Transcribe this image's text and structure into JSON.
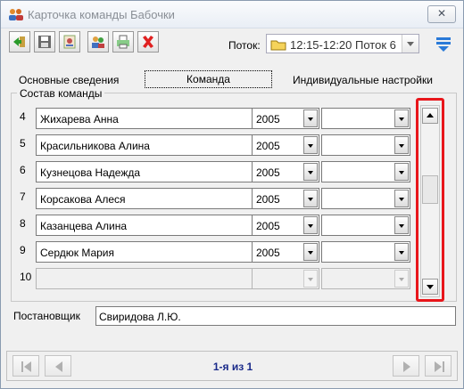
{
  "window": {
    "title": "Карточка команды Бабочки",
    "close_label": "✕"
  },
  "toolbar": {
    "buttons": [
      "exit-icon",
      "save-icon",
      "card-icon",
      "users-icon",
      "print-icon",
      "delete-icon"
    ],
    "flow_label": "Поток:",
    "flow_value": "12:15-12:20 Поток 6",
    "filter_icon": "filter-icon"
  },
  "tabs": [
    {
      "label": "Основные сведения"
    },
    {
      "label": "Команда",
      "active": true
    },
    {
      "label": "Индивидуальные настройки"
    }
  ],
  "team": {
    "group_label": "Состав команды",
    "rows": [
      {
        "num": "4",
        "name": "Жихарева Анна",
        "year": "2005",
        "extra": ""
      },
      {
        "num": "5",
        "name": "Красильникова Алина",
        "year": "2005",
        "extra": ""
      },
      {
        "num": "6",
        "name": "Кузнецова Надежда",
        "year": "2005",
        "extra": ""
      },
      {
        "num": "7",
        "name": "Корсакова Алеся",
        "year": "2005",
        "extra": ""
      },
      {
        "num": "8",
        "name": "Казанцева Алина",
        "year": "2005",
        "extra": ""
      },
      {
        "num": "9",
        "name": "Сердюк Мария",
        "year": "2005",
        "extra": ""
      },
      {
        "num": "10",
        "name": "",
        "year": "",
        "extra": ""
      }
    ]
  },
  "director": {
    "label": "Постановщик",
    "value": "Свиридова Л.Ю."
  },
  "navigation": {
    "record_text": "1-я из 1"
  },
  "colors": {
    "highlight": "#e8161b",
    "nav_text": "#1a2a8a"
  }
}
